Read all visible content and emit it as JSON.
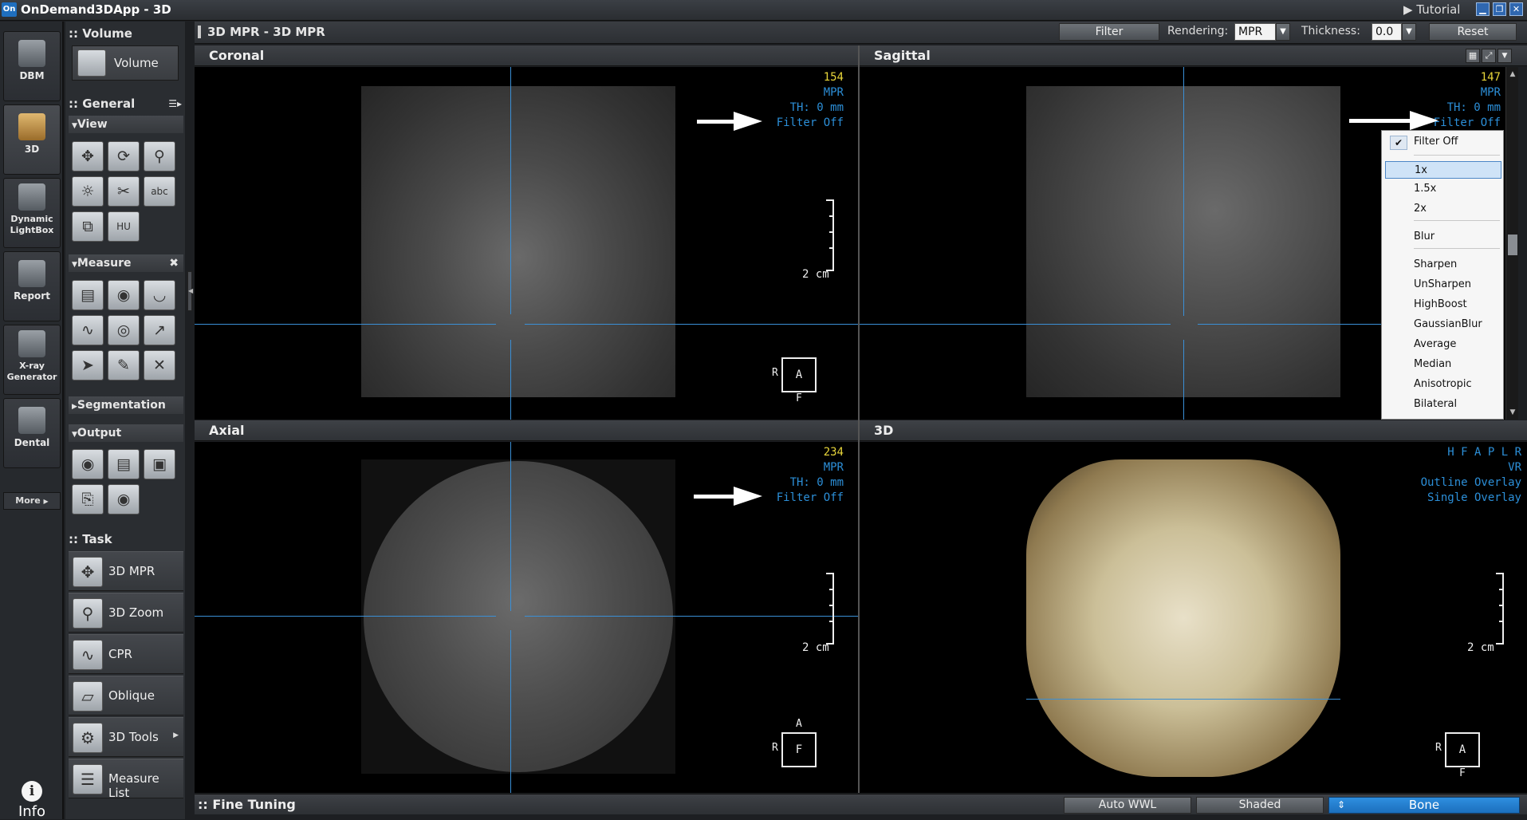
{
  "app": {
    "logo": "On",
    "title": "OnDemand3DApp - 3D",
    "tutorial": "Tutorial",
    "win_buttons": [
      "minimize-icon",
      "restore-icon",
      "close-icon"
    ]
  },
  "nav": {
    "items": [
      {
        "label": "DBM",
        "icon": "database-icon"
      },
      {
        "label": "3D",
        "icon": "skull-3d-icon",
        "active": true
      },
      {
        "label": "Dynamic LightBox",
        "icon": "lightbox-icon"
      },
      {
        "label": "Report",
        "icon": "report-icon"
      },
      {
        "label": "X-ray Generator",
        "icon": "xray-skull-icon"
      },
      {
        "label": "Dental",
        "icon": "tooth-icon"
      }
    ],
    "more": "More",
    "info": "Info"
  },
  "tools": {
    "volume_section": ":: Volume",
    "volume_button": "Volume",
    "general_section": ":: General",
    "view_label": "View",
    "view_icons": [
      "pan-icon",
      "rotate-icon",
      "zoom-icon",
      "brightness-icon",
      "scissors-icon",
      "annotation-text-icon",
      "copy-icon",
      "hu-icon"
    ],
    "measure_label": "Measure",
    "measure_icons": [
      "ruler-icon",
      "tape-measure-icon",
      "protractor-icon",
      "profile-icon",
      "globe-icon",
      "arrow-annotation-icon",
      "pointer-icon",
      "eraser-icon",
      "delete-icon"
    ],
    "segmentation_label": "Segmentation",
    "output_label": "Output",
    "output_icons": [
      "camera-icon",
      "clipboard-icon",
      "save-icon",
      "print-icon",
      "disc-icon"
    ],
    "task_section": ":: Task",
    "tasks": [
      {
        "label": "3D MPR",
        "icon": "mpr-icon"
      },
      {
        "label": "3D Zoom",
        "icon": "zoom-3d-icon"
      },
      {
        "label": "CPR",
        "icon": "cpr-icon"
      },
      {
        "label": "Oblique",
        "icon": "oblique-icon"
      },
      {
        "label": "3D Tools",
        "icon": "tools-3d-icon"
      },
      {
        "label": "Measure List",
        "icon": "list-icon"
      }
    ]
  },
  "toolbar": {
    "page_title": "3D MPR - 3D MPR",
    "filter": "Filter",
    "rendering_label": "Rendering:",
    "rendering_value": "MPR",
    "thickness_label": "Thickness:",
    "thickness_value": "0.0",
    "reset": "Reset"
  },
  "views": {
    "coronal": {
      "title": "Coronal",
      "slice": "154",
      "mode": "MPR",
      "th": "TH: 0 mm",
      "filter": "Filter Off",
      "scale": "2 cm",
      "orient_left": "R",
      "orient_box": "A",
      "orient_bottom": "F"
    },
    "sagittal": {
      "title": "Sagittal",
      "slice": "147",
      "mode": "MPR",
      "th": "TH: 0 mm",
      "filter": "Filter Off"
    },
    "axial": {
      "title": "Axial",
      "slice": "234",
      "mode": "MPR",
      "th": "TH: 0 mm",
      "filter": "Filter Off",
      "scale": "2 cm",
      "orient_top": "A",
      "orient_left": "R",
      "orient_box": "F"
    },
    "render3d": {
      "title": "3D",
      "directions": "H F A P L R",
      "mode": "VR",
      "overlay1": "Outline Overlay",
      "overlay2": "Single Overlay",
      "scale": "2 cm",
      "orient_left": "R",
      "orient_box": "A",
      "orient_bottom": "F"
    }
  },
  "filter_menu": {
    "checked": "Filter Off",
    "items": [
      "1x",
      "1.5x",
      "2x",
      "Blur",
      "Sharpen",
      "UnSharpen",
      "HighBoost",
      "GaussianBlur",
      "Average",
      "Median",
      "Anisotropic",
      "Bilateral"
    ],
    "selected": "1x"
  },
  "bottom": {
    "fine_tuning": ":: Fine Tuning",
    "auto_wwl": "Auto WWL",
    "shaded": "Shaded",
    "bone": "Bone"
  }
}
